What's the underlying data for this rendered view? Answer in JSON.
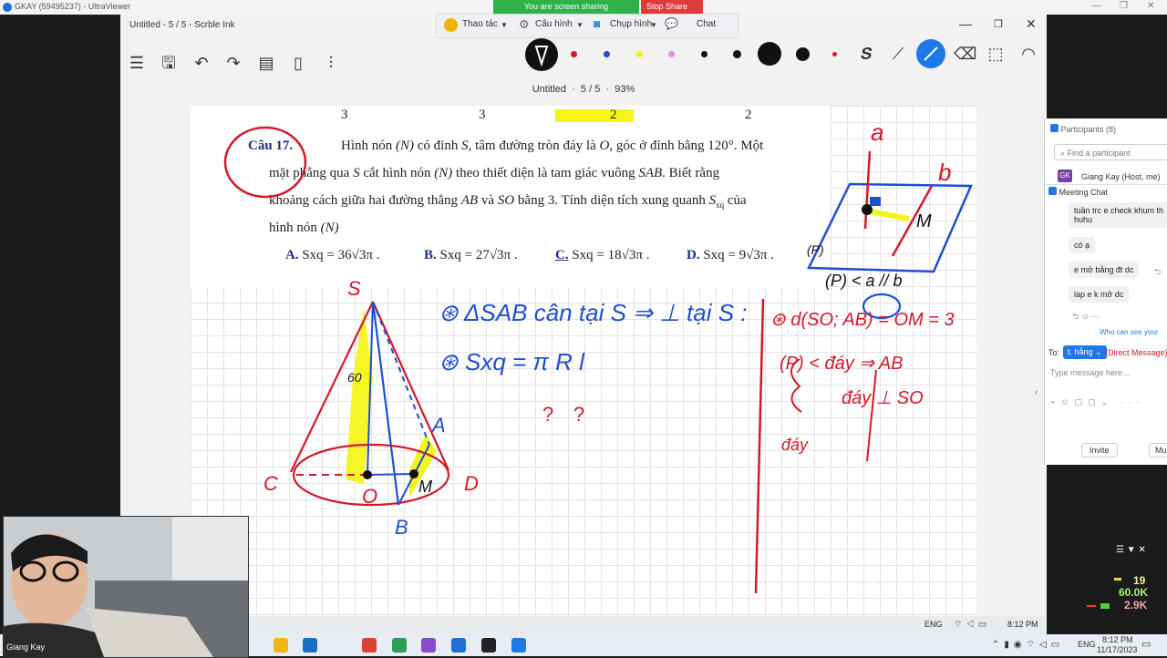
{
  "outer": {
    "title": "GKAY (59495237) - UltraViewer",
    "sharing": "You are screen sharing",
    "stop_share": "Stop Share"
  },
  "zoom_toolbar": {
    "items": [
      "Thao tác",
      "Cấu hình",
      "Chụp hình",
      "Chat"
    ]
  },
  "app": {
    "title": "Untitled - 5 / 5 - Scrble Ink",
    "doc_name": "Untitled",
    "page": "5 / 5",
    "zoom": "93%"
  },
  "question": {
    "top_row": [
      "3",
      "3",
      "2",
      "2"
    ],
    "label": "Câu 17.",
    "line1_a": "Hình nón",
    "line1_n": "(N)",
    "line1_b": "có đỉnh",
    "line1_s": "S",
    "line1_c": ", tâm đường tròn đáy là",
    "line1_o": "O",
    "line1_d": ", góc ở đỉnh bằng",
    "line1_angle": "120°",
    "line1_e": ". Một",
    "line2_a": "mặt phẳng qua",
    "line2_s": "S",
    "line2_b": "cắt hình nón",
    "line2_n": "(N)",
    "line2_c": "theo thiết diện là tam giác vuông",
    "line2_sab": "SAB",
    "line2_d": ". Biết rằng",
    "line3_a": "khoảng cách giữa hai đường thẳng",
    "line3_ab": "AB",
    "line3_b": "và",
    "line3_so": "SO",
    "line3_c": "bằng",
    "line3_3": "3",
    "line3_d": ". Tính diện tích xung quanh",
    "line3_sxq": "S",
    "line3_sub": "xq",
    "line3_e": "của",
    "line4_a": "hình nón",
    "line4_n": "(N)",
    "answers": [
      {
        "letter": "A.",
        "text": "Sxq = 36√3π ."
      },
      {
        "letter": "B.",
        "text": "Sxq = 27√3π ."
      },
      {
        "letter": "C.",
        "text": "Sxq = 18√3π ."
      },
      {
        "letter": "D.",
        "text": "Sxq = 9√3π ."
      }
    ]
  },
  "handwriting": {
    "cone_s": "S",
    "cone_c": "C",
    "cone_o": "O",
    "cone_a": "A",
    "cone_b": "B",
    "cone_d": "D",
    "cone_m": "M",
    "cone_60": "60",
    "note1": "⊛ ΔSAB cân tại S ⇒ ⊥ tại S :",
    "note2": "⊛ Sxq = π R l",
    "q1": "?",
    "q2": "?",
    "right1": "⊛ d(SO; AB) = OM = 3",
    "right2": "(P) < đáy ⇒ AB",
    "right3": "đáy ⊥ SO",
    "right4": "đáy",
    "plane_a": "a",
    "plane_b": "b",
    "plane_m": "M",
    "plane_p": "(P)",
    "plane_note": "(P) < a // b"
  },
  "zoom_panel": {
    "participants": "Participants (8)",
    "find": "Find a participant",
    "host_initials": "GK",
    "host": "Giang Kay (Host, me)",
    "chat_title": "Meeting Chat",
    "messages": [
      "tuần trc e check khum th huhu",
      "có ạ",
      "e mở bằng đt dc",
      "lap e k mở dc"
    ],
    "who_can_see": "Who can see your",
    "to_label": "To:",
    "to_recipient": "t. hằng",
    "direct": "(Direct Message)",
    "placeholder": "Type message here...",
    "invite": "Invite",
    "mute": "Mu"
  },
  "webcam": {
    "name": "Giang Kay"
  },
  "stats": {
    "fps": "19",
    "down": "60.0K",
    "up": "2.9K"
  },
  "inner_tray": {
    "lang": "ENG",
    "time": "8:12 PM"
  },
  "taskbar": {
    "lang": "ENG",
    "time": "8:12 PM",
    "date": "11/17/2023"
  },
  "colors": {
    "ink_red": "#d4182a",
    "ink_blue": "#1f4fd1",
    "ink_yellow": "#f6f51a",
    "accent": "#1e78e8"
  }
}
